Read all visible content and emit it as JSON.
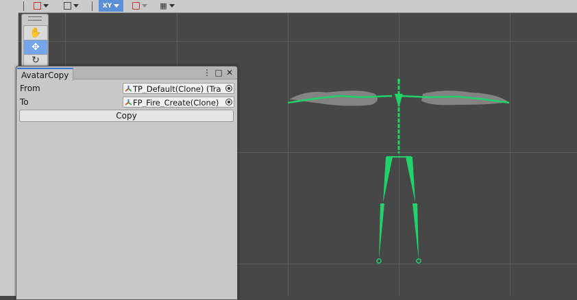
{
  "colors": {
    "accent": "#3a79d8",
    "skeleton": "#1fd36a",
    "scene_bg": "#474747"
  },
  "toolbar": {
    "items": [
      {
        "name": "gizmo-mode",
        "icon": "pencil-square-icon"
      },
      {
        "name": "cube-mode",
        "icon": "cube-icon"
      },
      {
        "name": "xy-view",
        "icon": "xy-axis-icon",
        "active": true
      },
      {
        "name": "lock-view",
        "icon": "lock-icon"
      },
      {
        "name": "grid-mode",
        "icon": "grid-icon"
      }
    ]
  },
  "tools": [
    {
      "name": "hand-tool",
      "icon": "hand-icon",
      "glyph": "✋"
    },
    {
      "name": "move-tool",
      "icon": "move-arrows-icon",
      "glyph": "✥",
      "active": true
    },
    {
      "name": "rotate-tool",
      "icon": "rotate-icon",
      "glyph": "↻"
    }
  ],
  "window": {
    "tab_title": "AvatarCopy",
    "menu_icon": "⋮",
    "max_icon": "□",
    "close_icon": "✕",
    "from_label": "From",
    "from_value": "TP_Default(Clone) (Tra",
    "to_label": "To",
    "to_value": "FP_Fire_Create(Clone)",
    "copy_label": "Copy"
  }
}
